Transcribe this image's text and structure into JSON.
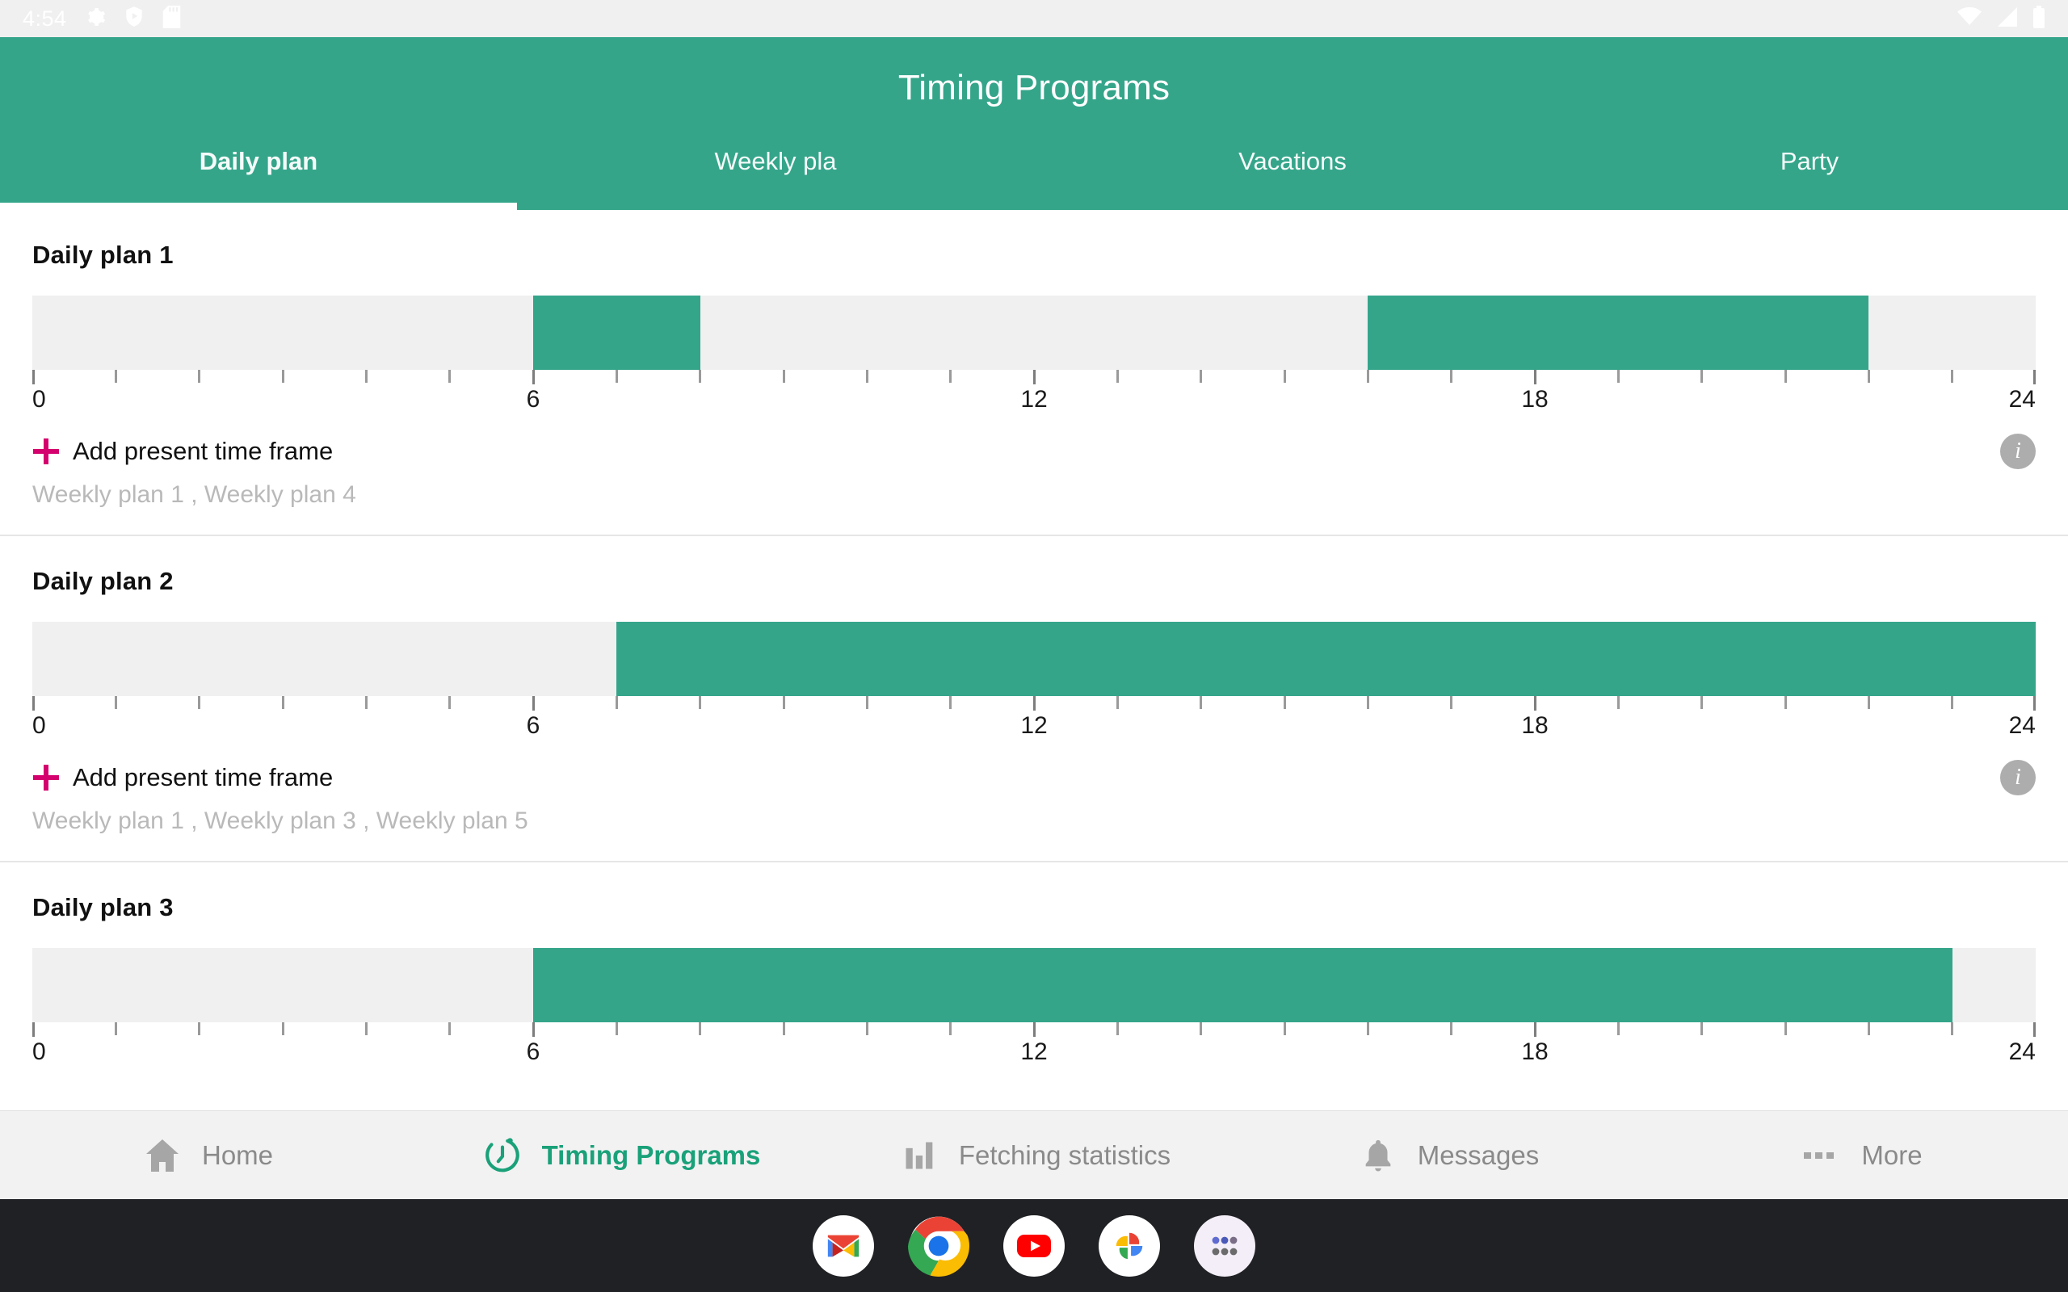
{
  "status_bar": {
    "clock": "4:54",
    "left_icons": [
      "gear-icon",
      "shield-play-icon",
      "sd-card-icon"
    ],
    "right_icons": [
      "wifi-icon",
      "signal-icon",
      "battery-icon"
    ]
  },
  "app_bar": {
    "title": "Timing Programs",
    "accent_color": "#35a58a",
    "tabs": [
      {
        "label": "Daily plan",
        "active": true
      },
      {
        "label": "Weekly pla",
        "active": false
      },
      {
        "label": "Vacations",
        "active": false
      },
      {
        "label": "Party",
        "active": false
      }
    ]
  },
  "axis": {
    "labels": [
      "0",
      "6",
      "12",
      "18",
      "24"
    ],
    "min": 0,
    "max": 24,
    "tick_step": 1
  },
  "common": {
    "add_time_frame_label": "Add present time frame",
    "info_glyph": "i",
    "plus_color": "#d4006e",
    "track_color": "#f0f0f0",
    "block_color": "#35a58a"
  },
  "plans": [
    {
      "title": "Daily plan 1",
      "blocks": [
        {
          "start": 6,
          "end": 8
        },
        {
          "start": 16,
          "end": 22
        }
      ],
      "add_label": "Add present time frame",
      "subtitle": "Weekly plan 1 , Weekly plan 4",
      "has_info": true
    },
    {
      "title": "Daily plan 2",
      "blocks": [
        {
          "start": 7,
          "end": 24
        }
      ],
      "add_label": "Add present time frame",
      "subtitle": "Weekly plan 1 , Weekly plan 3 , Weekly plan 5",
      "has_info": true
    },
    {
      "title": "Daily plan 3",
      "blocks": [
        {
          "start": 6,
          "end": 23
        }
      ],
      "add_label": "",
      "subtitle": "",
      "has_info": false
    }
  ],
  "bottom_nav": [
    {
      "label": "Home",
      "icon": "home-icon",
      "active": false
    },
    {
      "label": "Timing Programs",
      "icon": "timer-icon",
      "active": true
    },
    {
      "label": "Fetching statistics",
      "icon": "bar-chart-icon",
      "active": false
    },
    {
      "label": "Messages",
      "icon": "bell-icon",
      "active": false
    },
    {
      "label": "More",
      "icon": "more-dots-icon",
      "active": false
    }
  ],
  "dock": [
    {
      "name": "gmail-icon"
    },
    {
      "name": "chrome-icon"
    },
    {
      "name": "youtube-icon"
    },
    {
      "name": "google-photos-icon"
    },
    {
      "name": "app-drawer-icon"
    }
  ]
}
